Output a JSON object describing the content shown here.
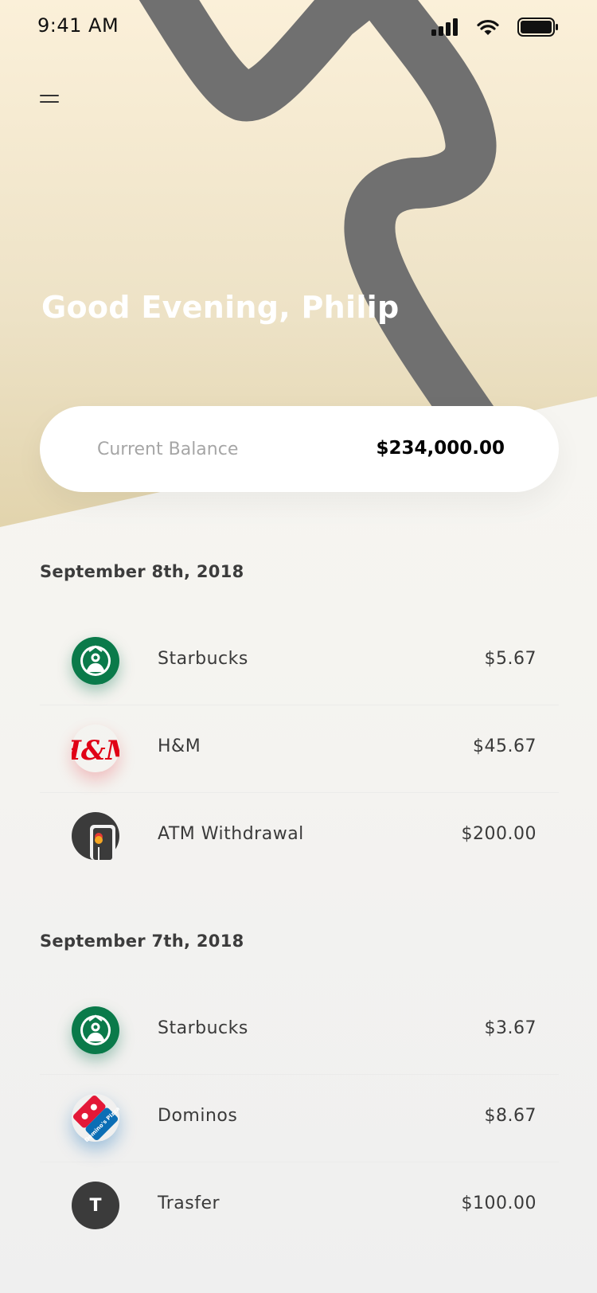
{
  "status_bar": {
    "time": "9:41 AM"
  },
  "header": {
    "greeting": "Good Evening, Philip"
  },
  "balance": {
    "label": "Current Balance",
    "amount": "$234,000.00"
  },
  "sections": [
    {
      "date": "September 8th, 2018",
      "transactions": [
        {
          "name": "Starbucks",
          "amount": "$5.67",
          "logo": "starbucks-logo"
        },
        {
          "name": "H&M",
          "amount": "$45.67",
          "logo": "hm-logo",
          "logo_text": "H&M"
        },
        {
          "name": "ATM Withdrawal",
          "amount": "$200.00",
          "logo": "atm-icon"
        }
      ]
    },
    {
      "date": "September 7th, 2018",
      "transactions": [
        {
          "name": "Starbucks",
          "amount": "$3.67",
          "logo": "starbucks-logo"
        },
        {
          "name": "Dominos",
          "amount": "$8.67",
          "logo": "dominos-logo",
          "logo_text": "Domino's Pizza"
        },
        {
          "name": "Trasfer",
          "amount": "$100.00",
          "logo": "transfer-avatar",
          "logo_text": "T"
        }
      ]
    }
  ],
  "colors": {
    "hero_top": "#f8ecd3",
    "hero_bottom": "#e6d8b6",
    "swoosh": "#707070",
    "starbucks": "#0a7a4a",
    "hm": "#e00016",
    "dominos_blue": "#0b6eb5",
    "dominos_red": "#e31837"
  }
}
